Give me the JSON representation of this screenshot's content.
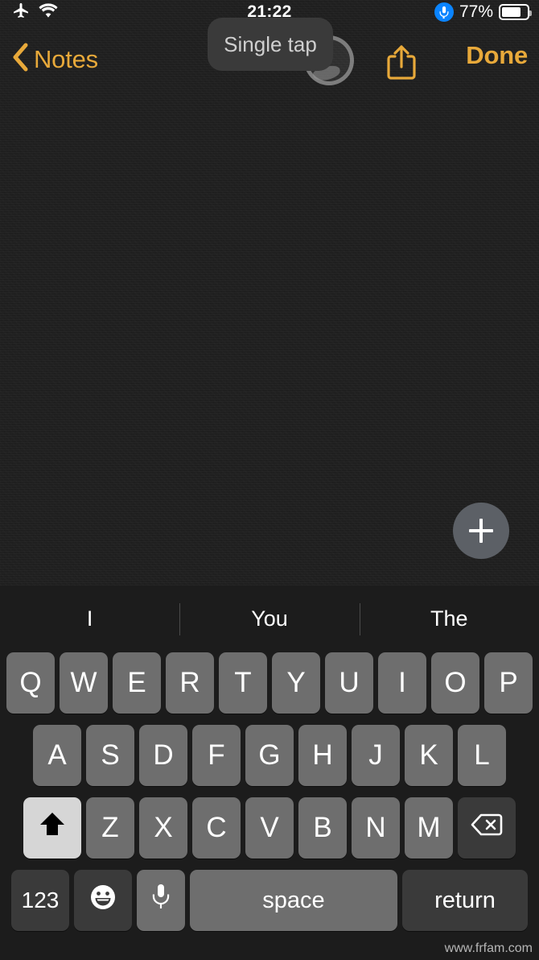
{
  "status_bar": {
    "airplane_icon": "airplane-icon",
    "wifi_icon": "wifi-icon",
    "time": "21:22",
    "mic_icon": "microphone-icon",
    "battery_percent": "77%",
    "battery_level": 77,
    "battery_icon": "battery-icon"
  },
  "nav_bar": {
    "back_label": "Notes",
    "back_icon": "chevron-left-icon",
    "share_icon": "share-icon",
    "done_label": "Done",
    "accent_color": "#e8a93a"
  },
  "overlay": {
    "tooltip_label": "Single tap",
    "gesture_indicator": "touch-ring-indicator"
  },
  "note": {
    "body_text": "",
    "background_color": "#1e1e1e"
  },
  "fab": {
    "icon": "plus-icon",
    "background_color": "#5c6066"
  },
  "keyboard": {
    "predictions": [
      "I",
      "You",
      "The"
    ],
    "row1": [
      "Q",
      "W",
      "E",
      "R",
      "T",
      "Y",
      "U",
      "I",
      "O",
      "P"
    ],
    "row2": [
      "A",
      "S",
      "D",
      "F",
      "G",
      "H",
      "J",
      "K",
      "L"
    ],
    "row3_letters": [
      "Z",
      "X",
      "C",
      "V",
      "B",
      "N",
      "M"
    ],
    "shift_icon": "shift-arrow-icon",
    "shift_active": true,
    "backspace_icon": "backspace-icon",
    "numbers_label": "123",
    "emoji_icon": "emoji-smiley-icon",
    "dictation_icon": "microphone-icon",
    "space_label": "space",
    "return_label": "return",
    "key_color": "#6e6e6e",
    "dark_key_color": "#3a3a3a",
    "shift_active_color": "#d6d6d6"
  },
  "watermark": {
    "text": "www.frfam.com"
  }
}
